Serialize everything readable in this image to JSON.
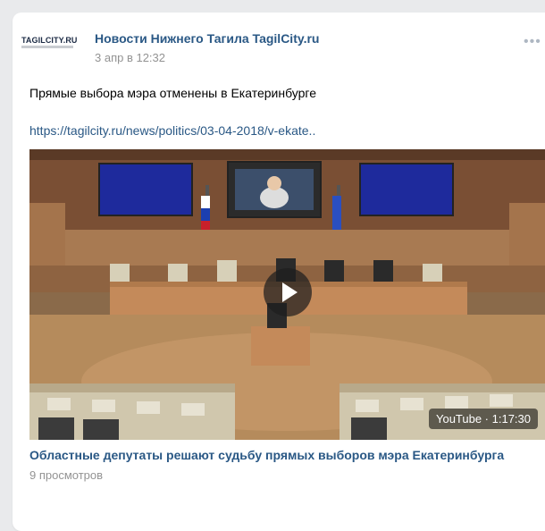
{
  "post": {
    "author_name": "Новости Нижнего Тагила TagilCity.ru",
    "date": "3 апр в 12:32",
    "avatar_logo": "TAGILCITY.RU",
    "text": "Прямые выбора мэра отменены в Екатеринбурге",
    "link": "https://tagilcity.ru/news/politics/03-04-2018/v-ekate..",
    "more_icon": "more-dots-icon"
  },
  "video": {
    "source_and_duration": "YouTube · 1:17:30",
    "title": "Областные депутаты решают судьбу прямых выборов мэра Екатеринбурга",
    "views": "9 просмотров",
    "play_icon": "play-icon"
  },
  "colors": {
    "link": "#2a5885",
    "meta": "#939393",
    "background": "#e9eaec"
  }
}
